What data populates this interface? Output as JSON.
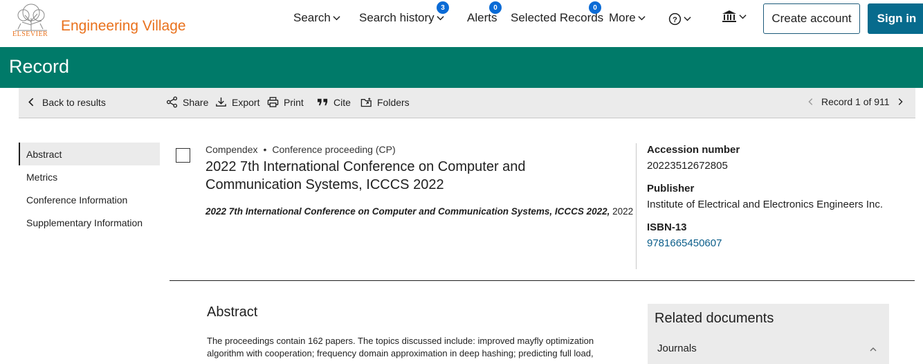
{
  "header": {
    "publisher_wordmark": "ELSEVIER",
    "brand": "Engineering Village",
    "nav": {
      "search": "Search",
      "search_history": "Search history",
      "search_history_badge": "3",
      "alerts": "Alerts",
      "alerts_badge": "0",
      "selected_records": "Selected Records",
      "selected_records_badge": "0",
      "more": "More"
    },
    "create_account": "Create account",
    "sign_in": "Sign in"
  },
  "banner": {
    "title": "Record"
  },
  "toolbar": {
    "back": "Back to results",
    "share": "Share",
    "export": "Export",
    "print": "Print",
    "cite": "Cite",
    "folders": "Folders",
    "record_position": "Record 1 of 911"
  },
  "sidebar": {
    "items": [
      {
        "label": "Abstract",
        "active": true
      },
      {
        "label": "Metrics"
      },
      {
        "label": "Conference Information"
      },
      {
        "label": "Supplementary Information"
      }
    ]
  },
  "record": {
    "database": "Compendex",
    "doc_type": "Conference proceeding (CP)",
    "title": "2022 7th International Conference on Computer and Communication Systems, ICCCS 2022",
    "source_title": "2022 7th International Conference on Computer and Communication Systems, ICCCS 2022,",
    "source_year": "2022"
  },
  "details": {
    "accession_label": "Accession number",
    "accession_value": "20223512672805",
    "publisher_label": "Publisher",
    "publisher_value": "Institute of Electrical and Electronics Engineers Inc.",
    "isbn_label": "ISBN-13",
    "isbn_value": "9781665450607"
  },
  "abstract": {
    "heading": "Abstract",
    "text": "The proceedings contain 162 papers. The topics discussed include: improved mayfly optimization algorithm with cooperation; frequency domain approximation in deep hashing; predicting full load,"
  },
  "related": {
    "heading": "Related documents",
    "journals": "Journals"
  },
  "colors": {
    "brand_orange": "#e9711c",
    "banner_teal": "#007a69",
    "signin_blue": "#076b8d",
    "badge_blue": "#0a6bd6",
    "link_blue": "#0b5e8a"
  }
}
